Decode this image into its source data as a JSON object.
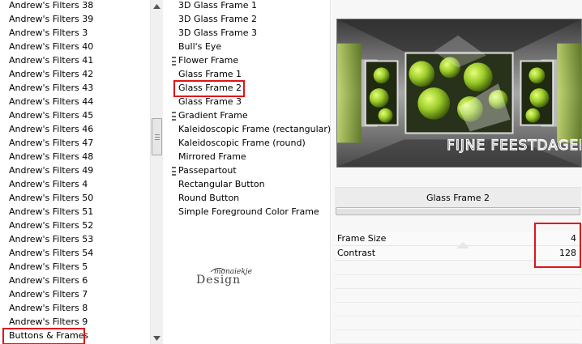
{
  "categories": [
    "Andrew's Filters 38",
    "Andrew's Filters 39",
    "Andrew's Filters 3",
    "Andrew's Filters 40",
    "Andrew's Filters 41",
    "Andrew's Filters 42",
    "Andrew's Filters 43",
    "Andrew's Filters 44",
    "Andrew's Filters 45",
    "Andrew's Filters 46",
    "Andrew's Filters 47",
    "Andrew's Filters 48",
    "Andrew's Filters 49",
    "Andrew's Filters 4",
    "Andrew's Filters 50",
    "Andrew's Filters 51",
    "Andrew's Filters 52",
    "Andrew's Filters 53",
    "Andrew's Filters 54",
    "Andrew's Filters 5",
    "Andrew's Filters 6",
    "Andrew's Filters 7",
    "Andrew's Filters 8",
    "Andrew's Filters 9",
    "Buttons & Frames"
  ],
  "selected_category": "Buttons & Frames",
  "filters": [
    "3D Glass Frame 1",
    "3D Glass Frame 2",
    "3D Glass Frame 3",
    "Bull's Eye",
    "Flower Frame",
    "Glass Frame 1",
    "Glass Frame 2",
    "Glass Frame 3",
    "Gradient Frame",
    "Kaleidoscopic Frame (rectangular)",
    "Kaleidoscopic Frame (round)",
    "Mirrored Frame",
    "Passepartout",
    "Rectangular Button",
    "Round Button",
    "Simple Foreground Color Frame"
  ],
  "selected_filter": "Glass Frame 2",
  "preview": {
    "caption": "FIJNE FEESTDAGEN"
  },
  "filter_name": "Glass Frame 2",
  "params": [
    {
      "label": "Frame Size",
      "value": "4"
    },
    {
      "label": "Contrast",
      "value": "128"
    }
  ],
  "logo": {
    "text": "Design",
    "script": "monaiekje"
  },
  "colors": {
    "highlight": "#e0141b",
    "preview_green": "#9ccc2a"
  },
  "icons": {
    "scroll_up": "triangle-up",
    "scroll_down": "triangle-down",
    "scroll_grip": "three-lines",
    "group_grip": "three-dashes"
  }
}
